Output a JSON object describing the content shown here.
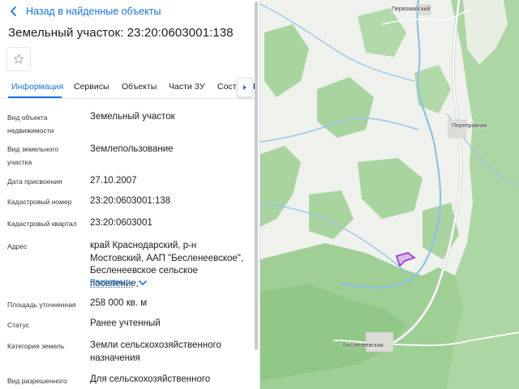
{
  "header": {
    "back_label": "Назад в найденные объекты",
    "title": "Земельный участок: 23:20:0603001:138"
  },
  "tabs": [
    {
      "label": "Информация",
      "active": true
    },
    {
      "label": "Сервисы"
    },
    {
      "label": "Объекты"
    },
    {
      "label": "Части ЗУ"
    },
    {
      "label": "Соста"
    },
    {
      "label": "П"
    }
  ],
  "details": {
    "object_type": {
      "label": "Вид объекта недвижимости",
      "value": "Земельный участок"
    },
    "land_type": {
      "label": "Вид земельного участка",
      "value": "Землепользование"
    },
    "assign_date": {
      "label": "Дата присвоения",
      "value": "27.10.2007"
    },
    "cadastral_number": {
      "label": "Кадастровый номер",
      "value": "23:20:0603001:138"
    },
    "cadastral_block": {
      "label": "Кадастровый квартал",
      "value": "23:20:0603001"
    },
    "address": {
      "label": "Адрес",
      "value": "край Краснодарский, р-н Мостовский, ААП \"Беслeнеевское\", Бесленеевское сельское поселение,",
      "expand_label": "Развернуть"
    },
    "area": {
      "label": "Площадь уточненная",
      "value": "258 000 кв. м"
    },
    "status": {
      "label": "Статус",
      "value": "Ранее учтенный"
    },
    "category": {
      "label": "Категория земель",
      "value": "Земли сельскохозяйственного назначения"
    },
    "permitted_use": {
      "label": "Вид разрешенного",
      "value": "Для сельскохозяйственного"
    }
  },
  "map": {
    "labels": {
      "pervomaysky": "Первомайский",
      "perepravnaya": "Переправная",
      "beslenevskaya": "Бесленеевская"
    },
    "colors": {
      "forest": "#a9d5a0",
      "forest_dark": "#8ec986",
      "open": "#f3f4f1",
      "river": "#9cc7e6",
      "road": "#ffffff",
      "road_edge": "#cfcfcf",
      "parcel": "#9b3fd1"
    }
  },
  "colors": {
    "accent": "#1a73d9"
  }
}
